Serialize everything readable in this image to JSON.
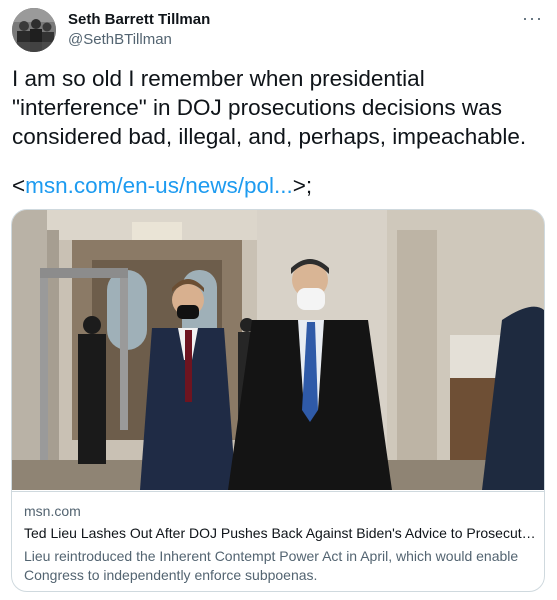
{
  "author": {
    "display_name": "Seth Barrett Tillman",
    "handle": "@SethBTillman",
    "avatar_icon": "profile-photo-icon"
  },
  "more_icon": "more-options-icon",
  "more_glyph": "···",
  "tweet": {
    "text": "I am so old I remember when presidential \"interference\" in DOJ prosecutions decisions was considered bad, illegal, and, perhaps, impeachable.",
    "link_prefix": "<",
    "link_text": "msn.com/en-us/news/pol...",
    "link_suffix": ">;"
  },
  "card": {
    "domain": "msn.com",
    "title": "Ted Lieu Lashes Out After DOJ Pushes Back Against Biden's Advice to Prosecute Bannon",
    "description": "Lieu reintroduced the Inherent Contempt Power Act in April, which would enable Congress to independently enforce subpoenas."
  },
  "colors": {
    "link": "#1d9bf0",
    "secondary_text": "#536471",
    "border": "#cfd9de"
  }
}
